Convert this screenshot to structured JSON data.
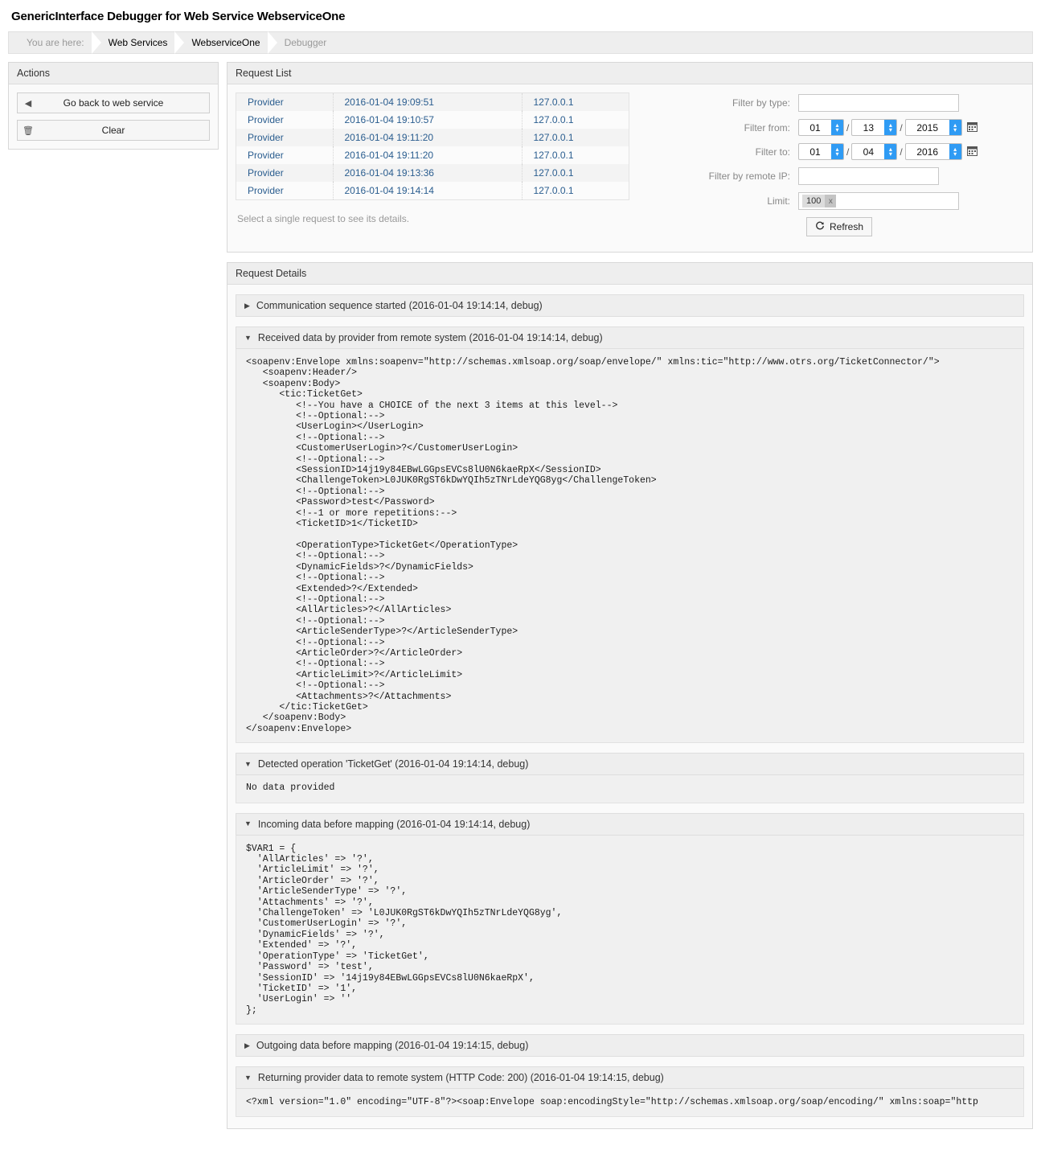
{
  "page": {
    "title": "GenericInterface Debugger for Web Service WebserviceOne"
  },
  "breadcrumb": {
    "prefix": "You are here:",
    "items": [
      "Web Services",
      "WebserviceOne",
      "Debugger"
    ]
  },
  "actions": {
    "header": "Actions",
    "buttons": [
      {
        "label": "Go back to web service",
        "icon": "back-arrow-icon"
      },
      {
        "label": "Clear",
        "icon": "trash-icon"
      }
    ]
  },
  "request_list": {
    "header": "Request List",
    "rows": [
      {
        "type": "Provider",
        "timestamp": "2016-01-04 19:09:51",
        "ip": "127.0.0.1"
      },
      {
        "type": "Provider",
        "timestamp": "2016-01-04 19:10:57",
        "ip": "127.0.0.1"
      },
      {
        "type": "Provider",
        "timestamp": "2016-01-04 19:11:20",
        "ip": "127.0.0.1"
      },
      {
        "type": "Provider",
        "timestamp": "2016-01-04 19:11:20",
        "ip": "127.0.0.1"
      },
      {
        "type": "Provider",
        "timestamp": "2016-01-04 19:13:36",
        "ip": "127.0.0.1"
      },
      {
        "type": "Provider",
        "timestamp": "2016-01-04 19:14:14",
        "ip": "127.0.0.1"
      }
    ],
    "hint": "Select a single request to see its details."
  },
  "filters": {
    "type": {
      "label": "Filter by type:",
      "value": ""
    },
    "from": {
      "label": "Filter from:",
      "month": "01",
      "day": "13",
      "year": "2015",
      "sep": "/"
    },
    "to": {
      "label": "Filter to:",
      "month": "01",
      "day": "04",
      "year": "2016",
      "sep": "/"
    },
    "remote_ip": {
      "label": "Filter by remote IP:",
      "value": ""
    },
    "limit": {
      "label": "Limit:",
      "token": "100",
      "remove": "x"
    },
    "refresh": {
      "label": "Refresh",
      "icon": "refresh-icon"
    }
  },
  "details": {
    "header": "Request Details",
    "sections": [
      {
        "id": "comm-sequence-started",
        "title": "Communication sequence started (2016-01-04 19:14:14, debug)",
        "expanded": false,
        "body": ""
      },
      {
        "id": "received-data-by-provider",
        "title": "Received data by provider from remote system (2016-01-04 19:14:14, debug)",
        "expanded": true,
        "body": "<soapenv:Envelope xmlns:soapenv=\"http://schemas.xmlsoap.org/soap/envelope/\" xmlns:tic=\"http://www.otrs.org/TicketConnector/\">\n   <soapenv:Header/>\n   <soapenv:Body>\n      <tic:TicketGet>\n         <!--You have a CHOICE of the next 3 items at this level-->\n         <!--Optional:-->\n         <UserLogin></UserLogin>\n         <!--Optional:-->\n         <CustomerUserLogin>?</CustomerUserLogin>\n         <!--Optional:-->\n         <SessionID>14j19y84EBwLGGpsEVCs8lU0N6kaeRpX</SessionID>\n         <ChallengeToken>L0JUK0RgST6kDwYQIh5zTNrLdeYQG8yg</ChallengeToken>\n         <!--Optional:-->\n         <Password>test</Password>\n         <!--1 or more repetitions:-->\n         <TicketID>1</TicketID>\n\n         <OperationType>TicketGet</OperationType>\n         <!--Optional:-->\n         <DynamicFields>?</DynamicFields>\n         <!--Optional:-->\n         <Extended>?</Extended>\n         <!--Optional:-->\n         <AllArticles>?</AllArticles>\n         <!--Optional:-->\n         <ArticleSenderType>?</ArticleSenderType>\n         <!--Optional:-->\n         <ArticleOrder>?</ArticleOrder>\n         <!--Optional:-->\n         <ArticleLimit>?</ArticleLimit>\n         <!--Optional:-->\n         <Attachments>?</Attachments>\n      </tic:TicketGet>\n   </soapenv:Body>\n</soapenv:Envelope>"
      },
      {
        "id": "detected-operation",
        "title": "Detected operation 'TicketGet' (2016-01-04 19:14:14, debug)",
        "expanded": true,
        "body": "No data provided"
      },
      {
        "id": "incoming-data-before-mapping",
        "title": "Incoming data before mapping (2016-01-04 19:14:14, debug)",
        "expanded": true,
        "body": "$VAR1 = {\n  'AllArticles' => '?',\n  'ArticleLimit' => '?',\n  'ArticleOrder' => '?',\n  'ArticleSenderType' => '?',\n  'Attachments' => '?',\n  'ChallengeToken' => 'L0JUK0RgST6kDwYQIh5zTNrLdeYQG8yg',\n  'CustomerUserLogin' => '?',\n  'DynamicFields' => '?',\n  'Extended' => '?',\n  'OperationType' => 'TicketGet',\n  'Password' => 'test',\n  'SessionID' => '14j19y84EBwLGGpsEVCs8lU0N6kaeRpX',\n  'TicketID' => '1',\n  'UserLogin' => ''\n};"
      },
      {
        "id": "outgoing-data-before-mapping",
        "title": "Outgoing data before mapping (2016-01-04 19:14:15, debug)",
        "expanded": false,
        "body": ""
      },
      {
        "id": "returning-provider-data",
        "title": "Returning provider data to remote system (HTTP Code: 200) (2016-01-04 19:14:15, debug)",
        "expanded": true,
        "body": "<?xml version=\"1.0\" encoding=\"UTF-8\"?><soap:Envelope soap:encodingStyle=\"http://schemas.xmlsoap.org/soap/encoding/\" xmlns:soap=\"http"
      }
    ]
  },
  "icons": {
    "triangle_collapsed": "▶",
    "triangle_expanded": "▼",
    "back_arrow": "◀",
    "trash": "🗑",
    "calendar": "▦",
    "refresh": "↻",
    "spinner_up": "▴",
    "spinner_down": "▾"
  },
  "colors": {
    "link": "#2a5d8f",
    "header_bg": "#eeeeee",
    "code_bg": "#f0f0f0",
    "accent_blue": "#2f9bf4"
  }
}
